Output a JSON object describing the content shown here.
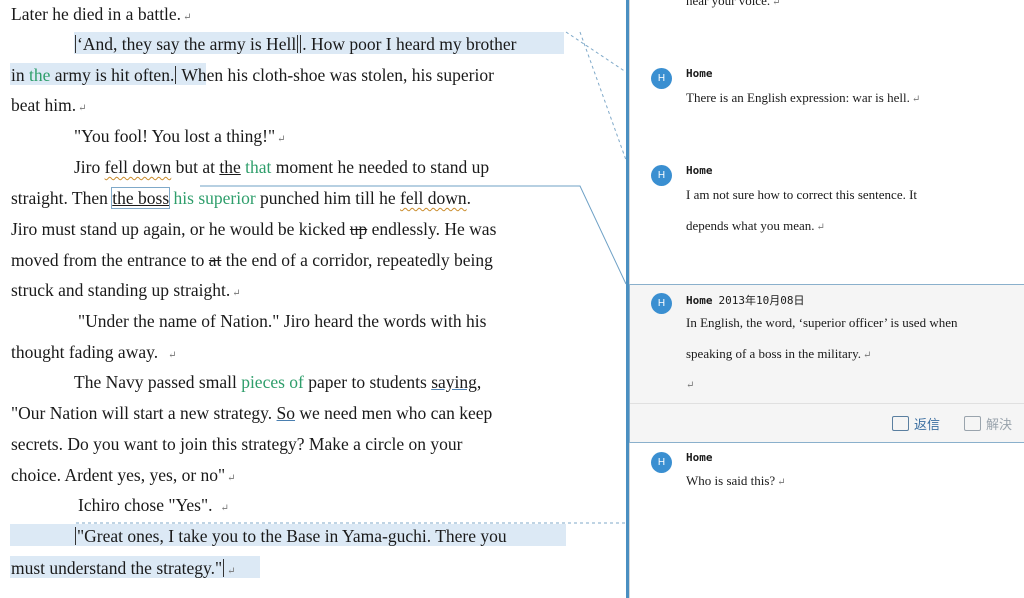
{
  "document": {
    "l1": "Later he died in a battle.",
    "l2a": "‘And, they say the army is Hell",
    "l2b": ". How poor I heard my brother",
    "l3a": "in ",
    "l3b": "the",
    "l3c": " army is hit often.",
    "l3d": " When his cloth-shoe was stolen, his superior",
    "l4": "beat him.",
    "l5": "\"You fool! You lost a thing!\"",
    "l6a": "Jiro ",
    "l6b": "fell down",
    "l6c": " but at ",
    "l6d": "the",
    "l6e": " ",
    "l6f": "that",
    "l6g": " moment he needed to stand up",
    "l7a": "straight. Then ",
    "l7b": "the boss",
    "l7c": " ",
    "l7d": "his superior",
    "l7e": " punched him till he ",
    "l7f": "fell down",
    "l7g": ".",
    "l8a": "Jiro must stand up again, or he would be kicked ",
    "l8b": "up",
    "l8c": " endlessly. He was",
    "l9a": "moved from the entrance to ",
    "l9b": "at",
    "l9c": " the end of a corridor, repeatedly being",
    "l10": "struck and standing up straight.",
    "l11": "\"Under the name of Nation.\" Jiro heard the words with his",
    "l12": "thought fading away.",
    "l13a": "The Navy passed small ",
    "l13b": "pieces of",
    "l13c": " paper to students ",
    "l13d": "saying,",
    "l14a": "\"Our Nation will start a new strategy. ",
    "l14b": "So",
    "l14c": " we need men who can keep",
    "l15": "secrets. Do you want to join this strategy? Make a circle on your",
    "l16": "choice. Ardent yes, yes, or no\"",
    "l17": "Ichiro chose \"Yes\".",
    "l18": "\"Great ones, I take you to the Base in Yama-guchi. There you",
    "l19": "must understand the strategy.\"",
    "para_mark": "↵"
  },
  "comments": {
    "c0_text": "hear your voice.",
    "c1": {
      "avatar": "H",
      "author": "Home",
      "text": "There is an English expression: war is hell."
    },
    "c2": {
      "avatar": "H",
      "author": "Home",
      "text1": "I am not sure how to correct this sentence. It",
      "text2": "depends what you mean."
    },
    "c3": {
      "avatar": "H",
      "author": "Home",
      "date": "2013年10月08日",
      "text1": "In English, the word, ‘superior officer’ is used when",
      "text2": "speaking of a boss in the military.",
      "reply_label": "返信",
      "resolve_label": "解決"
    },
    "c4": {
      "avatar": "H",
      "author": "Home",
      "text": "Who is said this?"
    }
  },
  "colors": {
    "accent": "#3a8fd1",
    "insertion": "#2e9e6b",
    "highlight": "#dce9f5",
    "separator": "#4a8fc1"
  }
}
